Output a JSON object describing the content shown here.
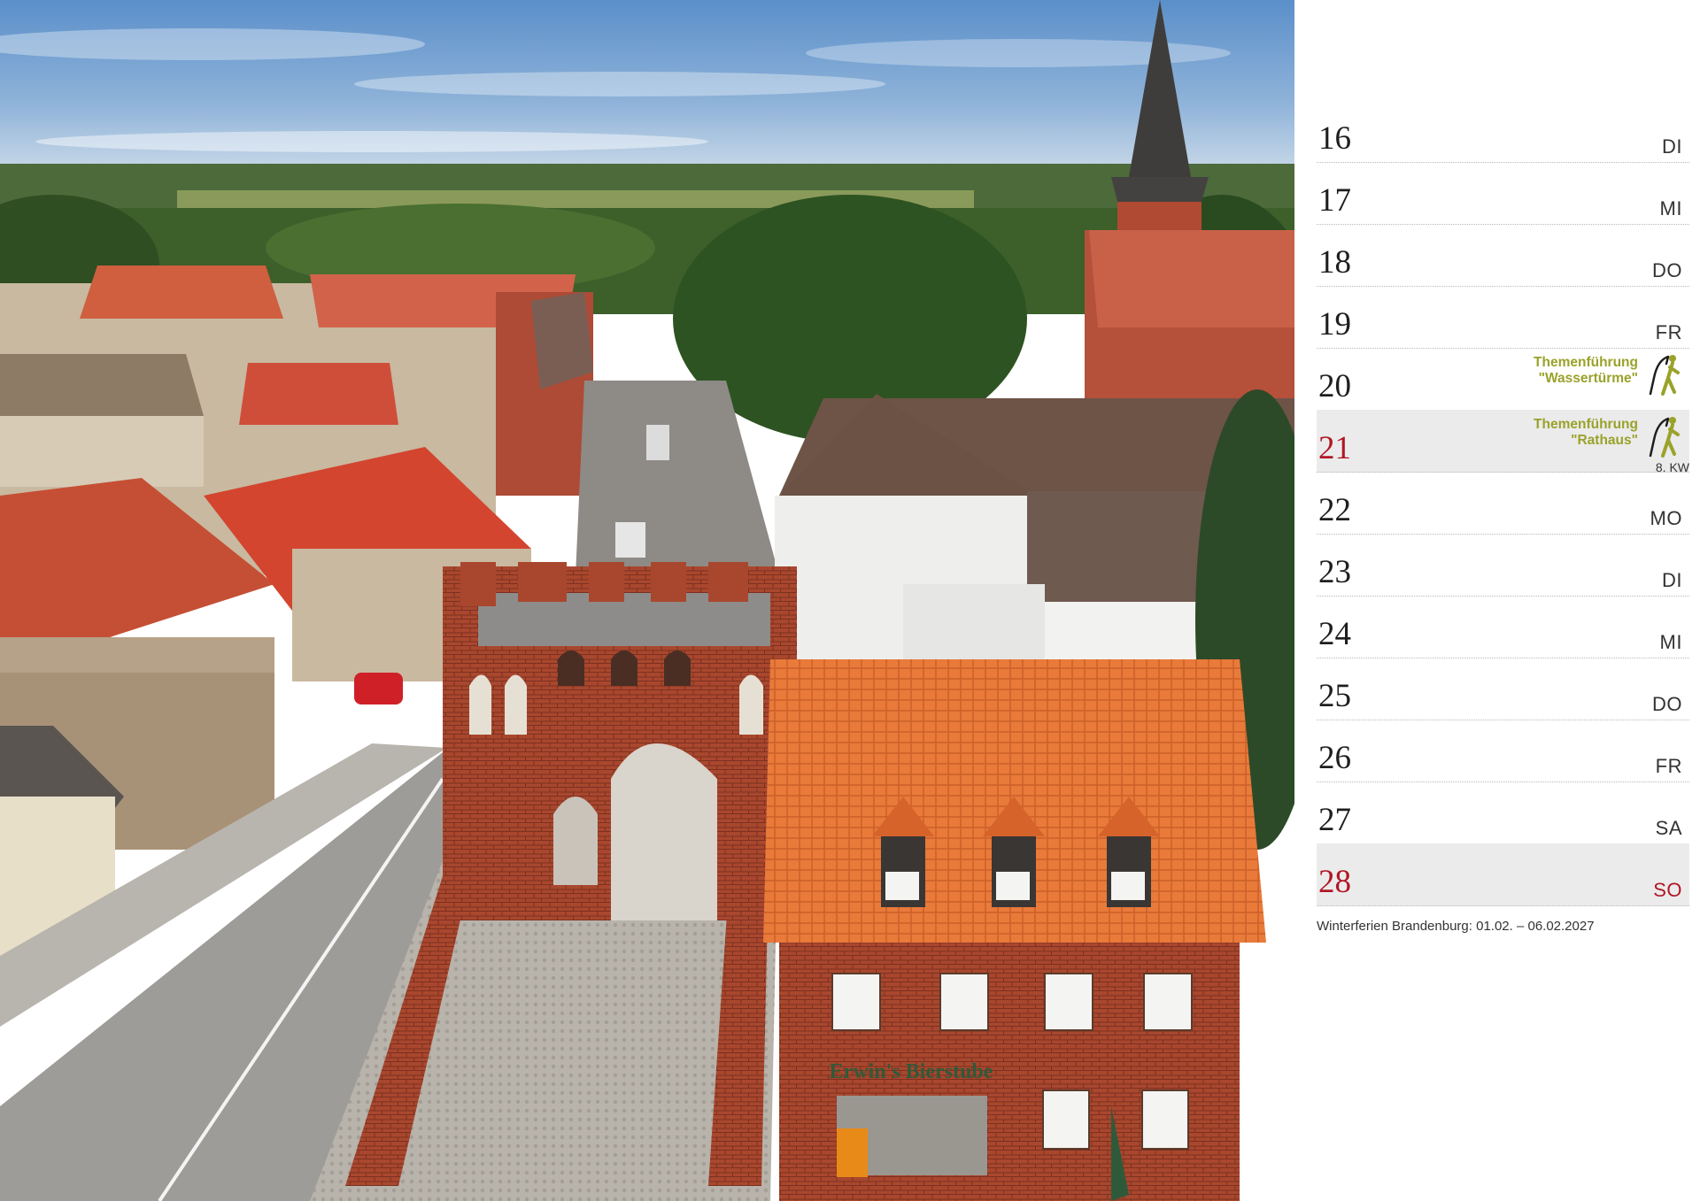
{
  "photo": {
    "signage": "Erwin's Bierstube"
  },
  "calendar": {
    "days": [
      {
        "num": "16",
        "day": "DI"
      },
      {
        "num": "17",
        "day": "MI"
      },
      {
        "num": "18",
        "day": "DO"
      },
      {
        "num": "19",
        "day": "FR"
      },
      {
        "num": "20",
        "day": "",
        "event_line1": "Themenführung",
        "event_line2": "\"Wassertürme\""
      },
      {
        "num": "21",
        "day": "",
        "event_line1": "Themenführung",
        "event_line2": "\"Rathaus\""
      },
      {
        "num": "22",
        "day": "MO",
        "week": "8. KW"
      },
      {
        "num": "23",
        "day": "DI"
      },
      {
        "num": "24",
        "day": "MI"
      },
      {
        "num": "25",
        "day": "DO"
      },
      {
        "num": "26",
        "day": "FR"
      },
      {
        "num": "27",
        "day": "SA"
      },
      {
        "num": "28",
        "day": "SO"
      }
    ],
    "footnote": "Winterferien Brandenburg: 01.02. – 06.02.2027"
  },
  "colors": {
    "sunday_red": "#b01726",
    "event_green": "#9aa22a",
    "shade": "#ebebeb"
  },
  "icons": {
    "event": "hiker-icon"
  }
}
